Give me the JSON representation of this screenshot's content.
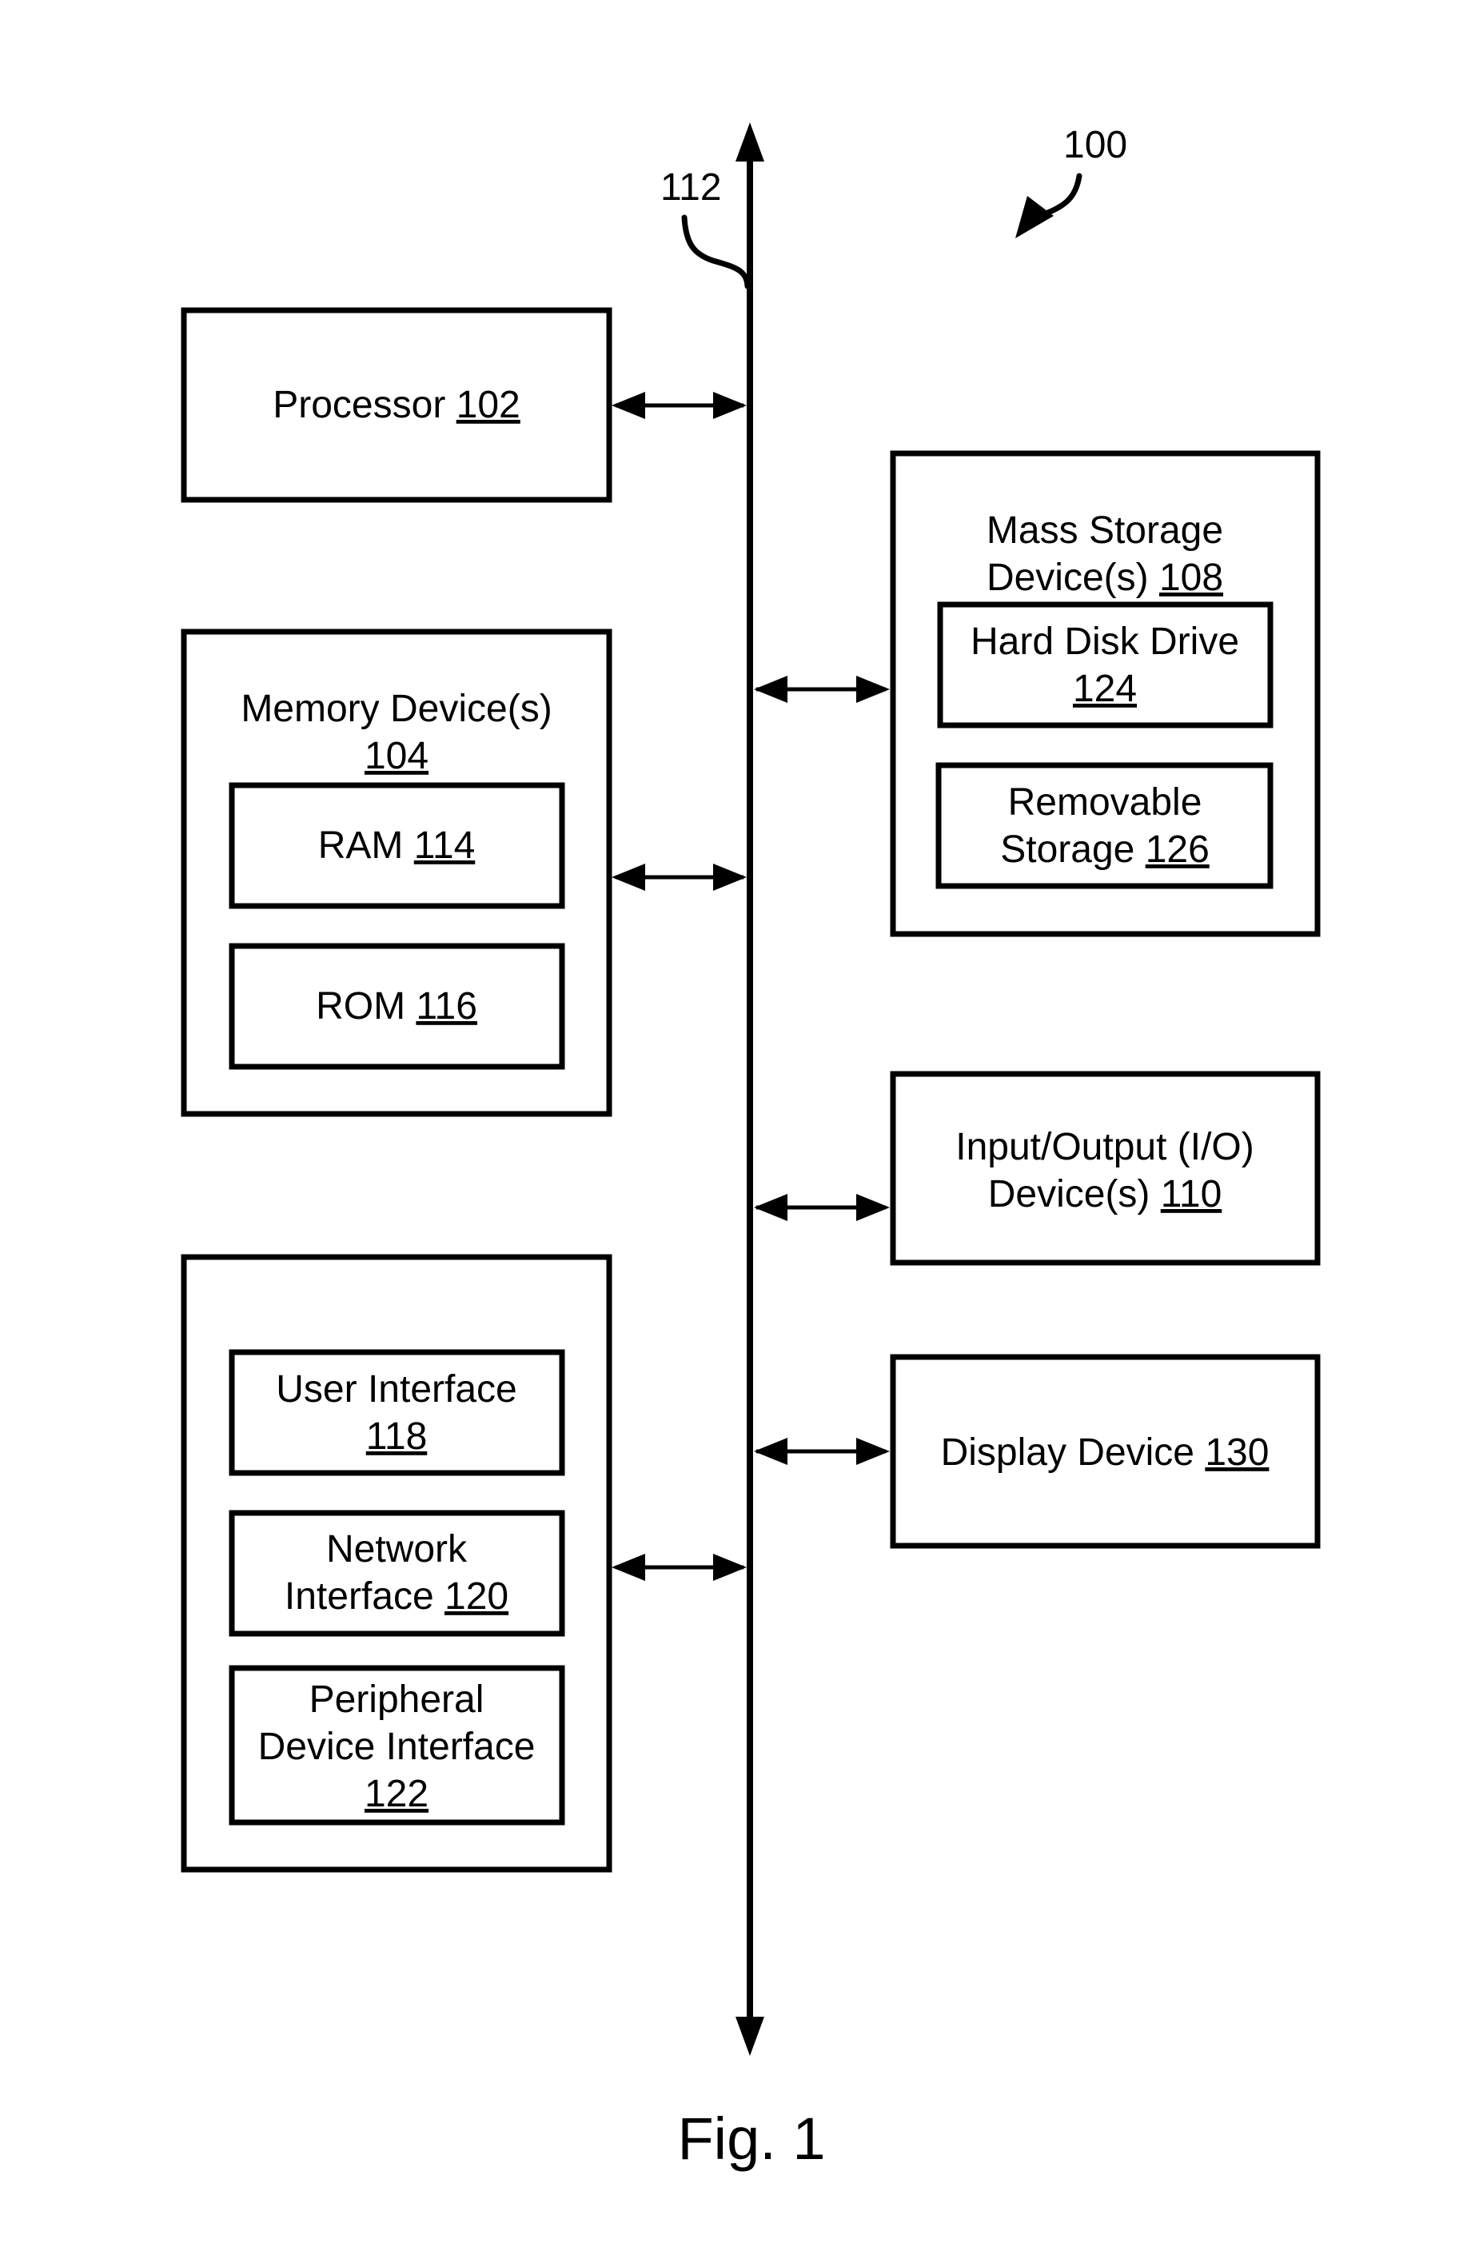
{
  "figure": {
    "caption": "Fig. 1",
    "system_ref": "100",
    "bus_ref": "112"
  },
  "components": {
    "processor": {
      "name": "Processor",
      "ref": "102"
    },
    "memory": {
      "name": "Memory Device(s)",
      "ref": "104",
      "children": {
        "ram": {
          "name": "RAM",
          "ref": "114"
        },
        "rom": {
          "name": "ROM",
          "ref": "116"
        }
      }
    },
    "interfaces": {
      "children": {
        "user_interface": {
          "line1": "User Interface",
          "ref": "118"
        },
        "network_interface": {
          "line1": "Network",
          "line2": "Interface",
          "ref": "120"
        },
        "peripheral_interface": {
          "line1": "Peripheral",
          "line2": "Device Interface",
          "ref": "122"
        }
      }
    },
    "mass_storage": {
      "line1": "Mass Storage",
      "line2": "Device(s)",
      "ref": "108",
      "children": {
        "hdd": {
          "line1": "Hard Disk Drive",
          "ref": "124"
        },
        "removable": {
          "line1": "Removable",
          "line2": "Storage",
          "ref": "126"
        }
      }
    },
    "io": {
      "line1": "Input/Output (I/O)",
      "line2": "Device(s)",
      "ref": "110"
    },
    "display": {
      "name": "Display Device",
      "ref": "130"
    }
  },
  "colors": {
    "ink": "#000000",
    "paper": "#ffffff"
  }
}
